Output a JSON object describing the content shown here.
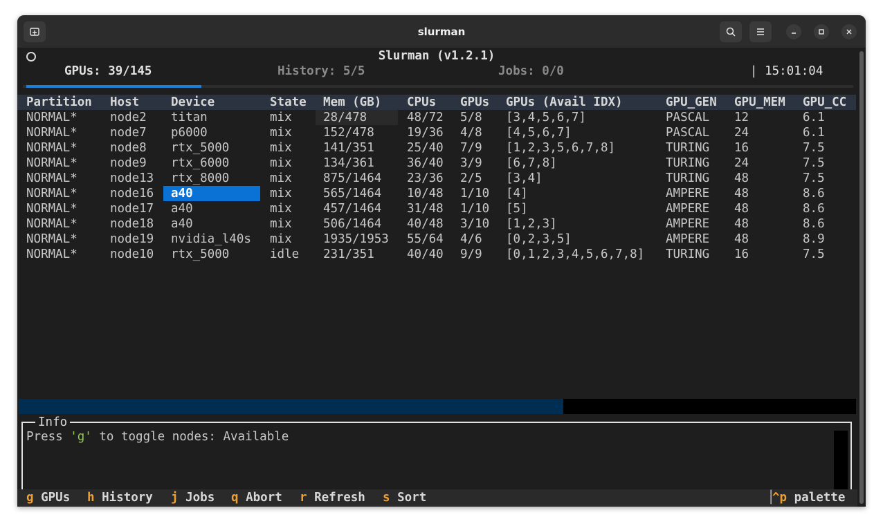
{
  "window": {
    "title": "slurman"
  },
  "header": {
    "app_title": "Slurman (v1.2.1)",
    "tabs": [
      {
        "label": "GPUs: 39/145",
        "active": true
      },
      {
        "label": "History: 5/5",
        "active": false
      },
      {
        "label": "Jobs: 0/0",
        "active": false
      }
    ],
    "clock": "| 15:01:04"
  },
  "table": {
    "columns": [
      "Partition",
      "Host",
      "Device",
      "State",
      "Mem (GB)",
      "CPUs",
      "GPUs",
      "GPUs (Avail IDX)",
      "GPU_GEN",
      "GPU_MEM",
      "GPU_CC"
    ],
    "rows": [
      [
        "NORMAL*",
        "node2",
        "titan",
        "mix",
        "28/478",
        "48/72",
        "5/8",
        "[3,4,5,6,7]",
        "PASCAL",
        "12",
        "6.1"
      ],
      [
        "NORMAL*",
        "node7",
        "p6000",
        "mix",
        "152/478",
        "19/36",
        "4/8",
        "[4,5,6,7]",
        "PASCAL",
        "24",
        "6.1"
      ],
      [
        "NORMAL*",
        "node8",
        "rtx_5000",
        "mix",
        "141/351",
        "25/40",
        "7/9",
        "[1,2,3,5,6,7,8]",
        "TURING",
        "16",
        "7.5"
      ],
      [
        "NORMAL*",
        "node9",
        "rtx_6000",
        "mix",
        "134/361",
        "36/40",
        "3/9",
        "[6,7,8]",
        "TURING",
        "24",
        "7.5"
      ],
      [
        "NORMAL*",
        "node13",
        "rtx_8000",
        "mix",
        "875/1464",
        "23/36",
        "2/5",
        "[3,4]",
        "TURING",
        "48",
        "7.5"
      ],
      [
        "NORMAL*",
        "node16",
        "a40",
        "mix",
        "565/1464",
        "10/48",
        "1/10",
        "[4]",
        "AMPERE",
        "48",
        "8.6"
      ],
      [
        "NORMAL*",
        "node17",
        "a40",
        "mix",
        "457/1464",
        "31/48",
        "1/10",
        "[5]",
        "AMPERE",
        "48",
        "8.6"
      ],
      [
        "NORMAL*",
        "node18",
        "a40",
        "mix",
        "506/1464",
        "40/48",
        "3/10",
        "[1,2,3]",
        "AMPERE",
        "48",
        "8.6"
      ],
      [
        "NORMAL*",
        "node19",
        "nvidia_l40s",
        "mix",
        "1935/1953",
        "55/64",
        "4/6",
        "[0,2,3,5]",
        "AMPERE",
        "48",
        "8.9"
      ],
      [
        "NORMAL*",
        "node10",
        "rtx_5000",
        "idle",
        "231/351",
        "40/40",
        "9/9",
        "[0,1,2,3,4,5,6,7,8]",
        "TURING",
        "16",
        "7.5"
      ]
    ],
    "selected_row": 5,
    "selected_col": 2
  },
  "scroll": {
    "horizontal_fraction": 0.65
  },
  "info": {
    "title": "Info",
    "text_before": "Press ",
    "key": "'g'",
    "text_after": " to toggle nodes: Available"
  },
  "footer": {
    "items": [
      {
        "key": "g",
        "label": "GPUs"
      },
      {
        "key": "h",
        "label": "History"
      },
      {
        "key": "j",
        "label": "Jobs"
      },
      {
        "key": "q",
        "label": "Abort"
      },
      {
        "key": "r",
        "label": "Refresh"
      },
      {
        "key": "s",
        "label": "Sort"
      }
    ],
    "palette_key": "^p",
    "palette_label": "palette"
  },
  "icons": {
    "new_tab": "new-tab-icon",
    "search": "search-icon",
    "menu": "hamburger-menu-icon",
    "minimize": "minimize-icon",
    "maximize": "maximize-icon",
    "close": "close-icon",
    "status": "status-circle-icon"
  },
  "colors": {
    "accent": "#1e80d8",
    "selection": "#0a72d4",
    "footer_key": "#f0a030",
    "info_key": "#8fc84a",
    "table_header_bg": "#2b3340"
  }
}
